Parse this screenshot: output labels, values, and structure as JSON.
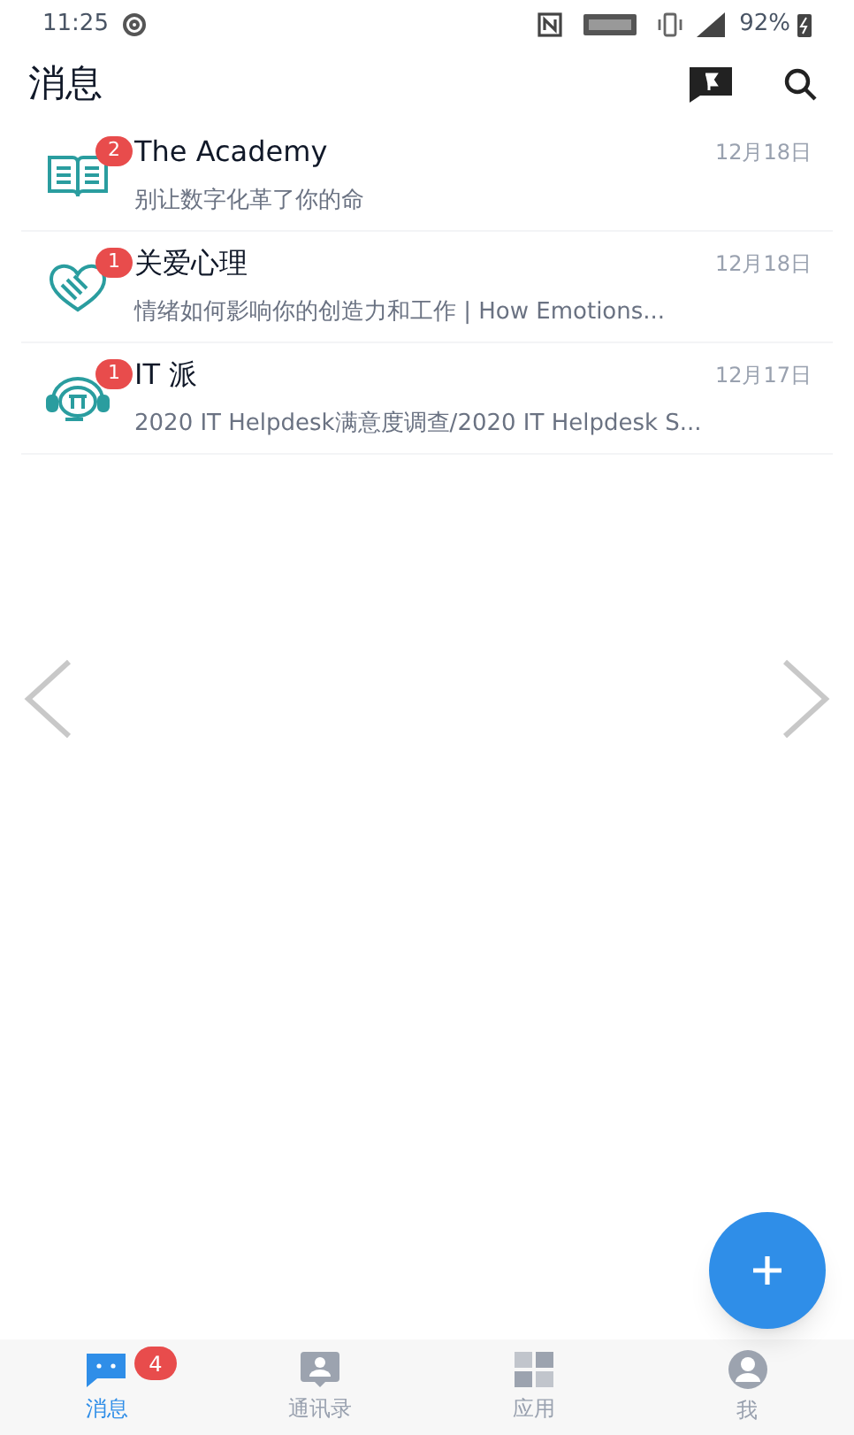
{
  "status_bar": {
    "time": "11:25",
    "battery": "92%"
  },
  "header": {
    "title": "消息"
  },
  "conversations": [
    {
      "kind": "book",
      "name": "The Academy",
      "unread": "2",
      "date": "12月18日",
      "preview": "别让数字化革了你的命"
    },
    {
      "kind": "heart",
      "name": "关爱心理",
      "unread": "1",
      "date": "12月18日",
      "preview": "情绪如何影响你的创造力和工作 | How Emotions..."
    },
    {
      "kind": "pi",
      "name": "IT 派",
      "unread": "1",
      "date": "12月17日",
      "preview": "2020 IT Helpdesk满意度调查/2020 IT Helpdesk S..."
    }
  ],
  "tabs": [
    {
      "kind": "messages",
      "label": "消息",
      "selected": true,
      "badge": "4"
    },
    {
      "kind": "contacts",
      "label": "通讯录",
      "selected": false
    },
    {
      "kind": "apps",
      "label": "应用",
      "selected": false
    },
    {
      "kind": "me",
      "label": "我",
      "selected": false
    }
  ]
}
